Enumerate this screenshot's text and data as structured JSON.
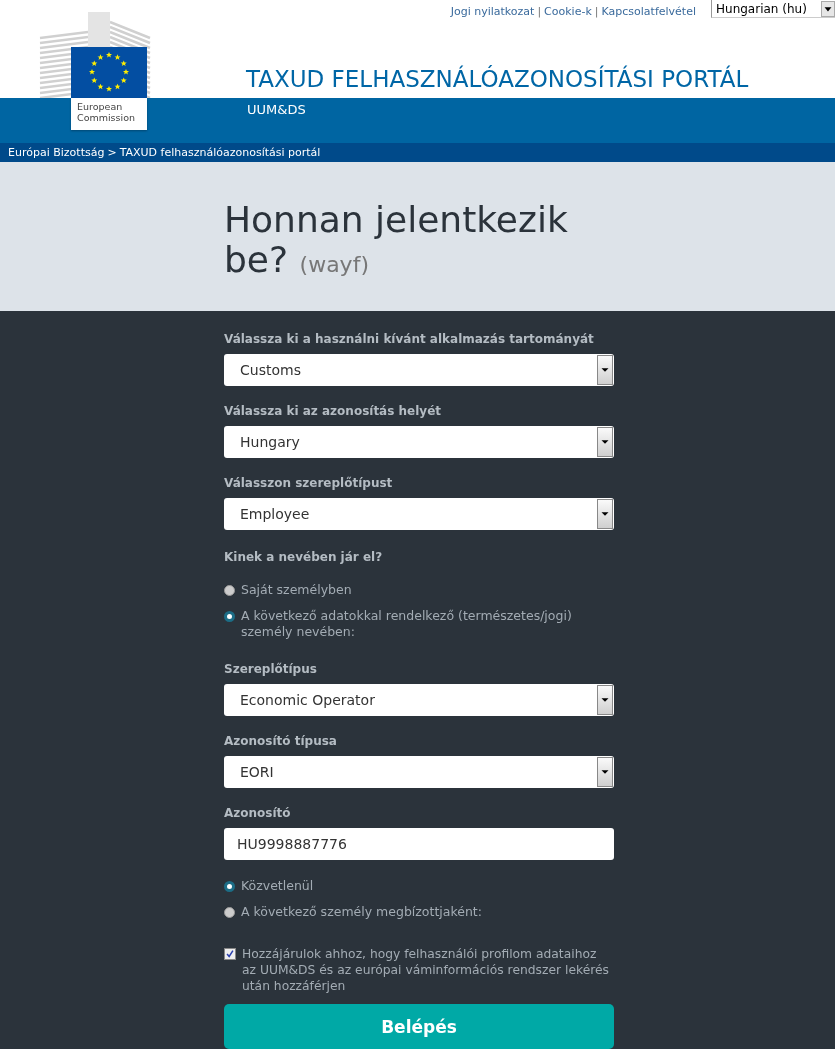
{
  "top_links": [
    "Jogi nyilatkozat",
    "Cookie-k",
    "Kapcsolatfelvétel"
  ],
  "top_links_separator": "|",
  "language_select": {
    "value": "Hungarian (hu)"
  },
  "logo": {
    "label": "European Commission"
  },
  "site": {
    "title": "TAXUD FELHASZNÁLÓAZONOSÍTÁSI PORTÁL",
    "subtitle": "UUM&DS"
  },
  "breadcrumb": [
    "Európai Bizottság",
    "TAXUD felhasználóazonosítási portál"
  ],
  "breadcrumb_separator": ">",
  "page": {
    "title": "Honnan jelentkezik be?",
    "hint": "(wayf)"
  },
  "form": {
    "fields": [
      {
        "kind": "select",
        "label": "Válassza ki a használni kívánt alkalmazás tartományát",
        "value": "Customs"
      },
      {
        "kind": "select",
        "label": "Válassza ki az azonosítás helyét",
        "value": "Hungary"
      },
      {
        "kind": "select",
        "label": "Válasszon szereplőtípust",
        "value": "Employee"
      },
      {
        "kind": "question",
        "label": "Kinek a nevében jár el?"
      },
      {
        "kind": "radio",
        "label": "Saját személyben",
        "selected": false
      },
      {
        "kind": "radio",
        "label": "A következő adatokkal rendelkező (természetes/jogi) személy nevében:",
        "selected": true
      },
      {
        "kind": "select",
        "label": "Szereplőtípus",
        "value": "Economic Operator"
      },
      {
        "kind": "select",
        "label": "Azonosító típusa",
        "value": "EORI"
      },
      {
        "kind": "input",
        "label": "Azonosító",
        "value": "HU9998887776"
      },
      {
        "kind": "radio",
        "label": "Közvetlenül",
        "selected": true
      },
      {
        "kind": "radio",
        "label": "A következő személy megbízottjaként:",
        "selected": false
      },
      {
        "kind": "checkbox",
        "label": "Hozzájárulok ahhoz, hogy felhasználói profilom adataihoz az UUM&DS és az európai váminformációs rendszer lekérés után hozzáférjen",
        "checked": true
      }
    ],
    "submit": "Belépés"
  }
}
